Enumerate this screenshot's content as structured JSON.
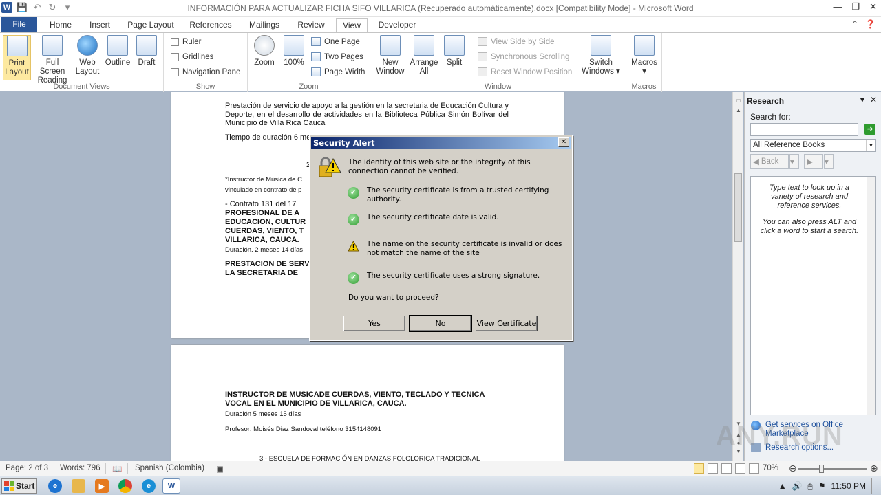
{
  "window": {
    "title": "INFORMACIÓN PARA ACTUALIZAR FICHA SIFO VILLARICA (Recuperado automáticamente).docx [Compatibility Mode]  -  Microsoft Word",
    "app_logo": "W"
  },
  "tabs": [
    "File",
    "Home",
    "Insert",
    "Page Layout",
    "References",
    "Mailings",
    "Review",
    "View",
    "Developer"
  ],
  "ribbon": {
    "document_views": {
      "label": "Document Views",
      "buttons": [
        "Print Layout",
        "Full Screen Reading",
        "Web Layout",
        "Outline",
        "Draft"
      ]
    },
    "show": {
      "label": "Show",
      "items": [
        "Ruler",
        "Gridlines",
        "Navigation Pane"
      ]
    },
    "zoom": {
      "label": "Zoom",
      "zoom_btn": "Zoom",
      "hundred_btn": "100%",
      "one_page": "One Page",
      "two_pages": "Two Pages",
      "page_width": "Page Width"
    },
    "window": {
      "label": "Window",
      "new_window": "New Window",
      "arrange_all": "Arrange All",
      "split": "Split",
      "view_side": "View Side by Side",
      "sync_scroll": "Synchronous Scrolling",
      "reset_pos": "Reset Window Position",
      "switch_windows": "Switch Windows"
    },
    "macros": {
      "label": "Macros",
      "button": "Macros"
    }
  },
  "document": {
    "page1": {
      "para1": "Prestación de servicio de apoyo a la gestión en la secretaria de Educación Cultura y Deporte, en el desarrollo de actividades en la Biblioteca Pública Simón Bolívar del Municipio de Villa Rica Cauca",
      "duration": "Tiempo de duración 6 me",
      "num": "2",
      "instructor": "*Instructor de Música de C",
      "vinculado": "vinculado en contrato de p",
      "contrato": "- Contrato 131 del 17",
      "bold1": "PROFESIONAL DE A",
      "bold2": "EDUCACION, CULTUR",
      "bold3": "CUERDAS, VIENTO, T",
      "bold4": "VILLARICA, CAUCA.",
      "dur2": "Duración. 2 meses 14 días",
      "bold5": "PRESTACION DE SERV",
      "bold6": "LA SECRETARIA DE"
    },
    "page2": {
      "heading1": "INSTRUCTOR DE MUSICADE CUERDAS, VIENTO, TECLADO Y TECNICA",
      "heading2": "VOCAL EN EL MUNICIPIO DE VILLARICA, CAUCA.",
      "duration": "Duración 5 meses 15 días",
      "profesor": "Profesor: Moisés Diaz Sandoval teléfono 3154148091",
      "escuela": "3.- ESCUELA DE FORMACIÓN EN DANZAS FOLCLORICA TRADICIONAL"
    }
  },
  "research": {
    "title": "Research",
    "search_for": "Search for:",
    "search_value": "",
    "source": "All Reference Books",
    "back": "Back",
    "hint1": "Type text to look up in a variety of research and reference services.",
    "hint2": "You can also press ALT and click a word to start a search.",
    "link1": "Get services on Office Marketplace",
    "link2": "Research options..."
  },
  "status": {
    "page": "Page: 2 of 3",
    "words": "Words: 796",
    "language": "Spanish (Colombia)",
    "zoom": "70%"
  },
  "taskbar": {
    "start": "Start",
    "time": "11:50 PM"
  },
  "dialog": {
    "title": "Security Alert",
    "intro": "The identity of this web site or the integrity of this connection cannot be verified.",
    "check1": "The security certificate is from a trusted certifying authority.",
    "check2": "The security certificate date is valid.",
    "warn": "The name on the security certificate is invalid or does not match the name of the site",
    "check3": "The security certificate uses a strong signature.",
    "question": "Do you want to proceed?",
    "yes": "Yes",
    "no": "No",
    "view_cert": "View Certificate"
  },
  "watermark": "ANY.RUN",
  "colors": {
    "word_blue": "#2b579a",
    "dialog_face": "#d4d0c8",
    "titlebar_dark": "#0a246a",
    "doc_bg": "#aab7c8"
  }
}
